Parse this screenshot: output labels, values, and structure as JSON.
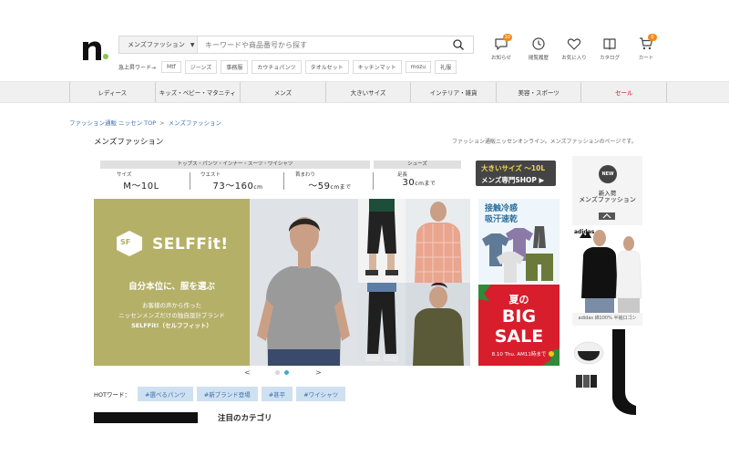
{
  "header": {
    "search": {
      "category": "メンズファッション",
      "placeholder": "キーワードや商品番号から探す"
    },
    "hot_label": "急上昇ワード→",
    "hot_words": [
      "Mtf",
      "ジーンズ",
      "事務服",
      "カウチョパンツ",
      "タオルセット",
      "キッチンマット",
      "mozu",
      "礼服"
    ],
    "utilities": [
      {
        "label": "お知らせ",
        "icon": "chat-bubble-icon",
        "badge": "10"
      },
      {
        "label": "閲覧履歴",
        "icon": "clock-icon",
        "badge": ""
      },
      {
        "label": "お気に入り",
        "icon": "heart-icon",
        "badge": ""
      },
      {
        "label": "カタログ",
        "icon": "book-icon",
        "badge": ""
      },
      {
        "label": "カート",
        "icon": "cart-icon",
        "badge": "0"
      }
    ]
  },
  "nav": {
    "items": [
      "レディース",
      "キッズ・ベビー・マタニティ",
      "メンズ",
      "大きいサイズ",
      "インテリア・雑貨",
      "美容・スポーツ",
      "セール"
    ]
  },
  "breadcrumb": [
    "ファッション通販 ニッセン TOP",
    "メンズファッション"
  ],
  "breadcrumb_sep": ">",
  "page": {
    "title": "メンズファッション",
    "description": "ファッション通販ニッセンオンライン。メンズファッションのページです。"
  },
  "size_guide": {
    "group_label": "トップス・パンツ・インナー・スーツ・ワイシャツ",
    "shoe_label": "シューズ",
    "items": [
      {
        "key": "サイズ",
        "value": "M～10L",
        "unit": ""
      },
      {
        "key": "ウエスト",
        "value": "73～160",
        "unit": "cm"
      },
      {
        "key": "首まわり",
        "value": "～59",
        "unit": "cmまで"
      },
      {
        "key": "足長",
        "value": "30",
        "unit": "cmまで"
      }
    ],
    "big_size_line1": "大きいサイズ ～10L",
    "big_size_line2": "メンズ専門SHOP ▶"
  },
  "hero": {
    "brand_mark": "SF",
    "brand": "SELFFit!",
    "tagline": "自分本位に、服を選ぶ",
    "copy_lines": [
      "お客様の声から作った",
      "ニッセンメンズだけの独自設計ブランド",
      "SELFFit!（セルフフィット）"
    ],
    "prev": "<",
    "next": ">"
  },
  "side_banners": {
    "cool_title_lines": [
      "接触冷感",
      "吸汗速乾"
    ],
    "sale_line1": "夏の",
    "sale_line2": "BIG",
    "sale_line3": "SALE",
    "sale_line4": "8.10 Thu. AM11時まで"
  },
  "right_column": {
    "new_badge": "NEW",
    "new_line1": "新入荷",
    "new_line2": "メンズファッション",
    "brand_logo": "adidas",
    "caption": "adidas 綿100% 半袖口ゴシ"
  },
  "hot_words": {
    "label": "HOTワード：",
    "chips": [
      "#選べるパンツ",
      "#新ブランド登場",
      "#甚平",
      "#ワイシャツ"
    ]
  },
  "attention_title": "注目のカテゴリ",
  "colors": {
    "accent_blue": "#3a6fb0",
    "badge_orange": "#f28a1b",
    "sale_red": "#d81e2c",
    "hero_olive": "#b5b068"
  }
}
